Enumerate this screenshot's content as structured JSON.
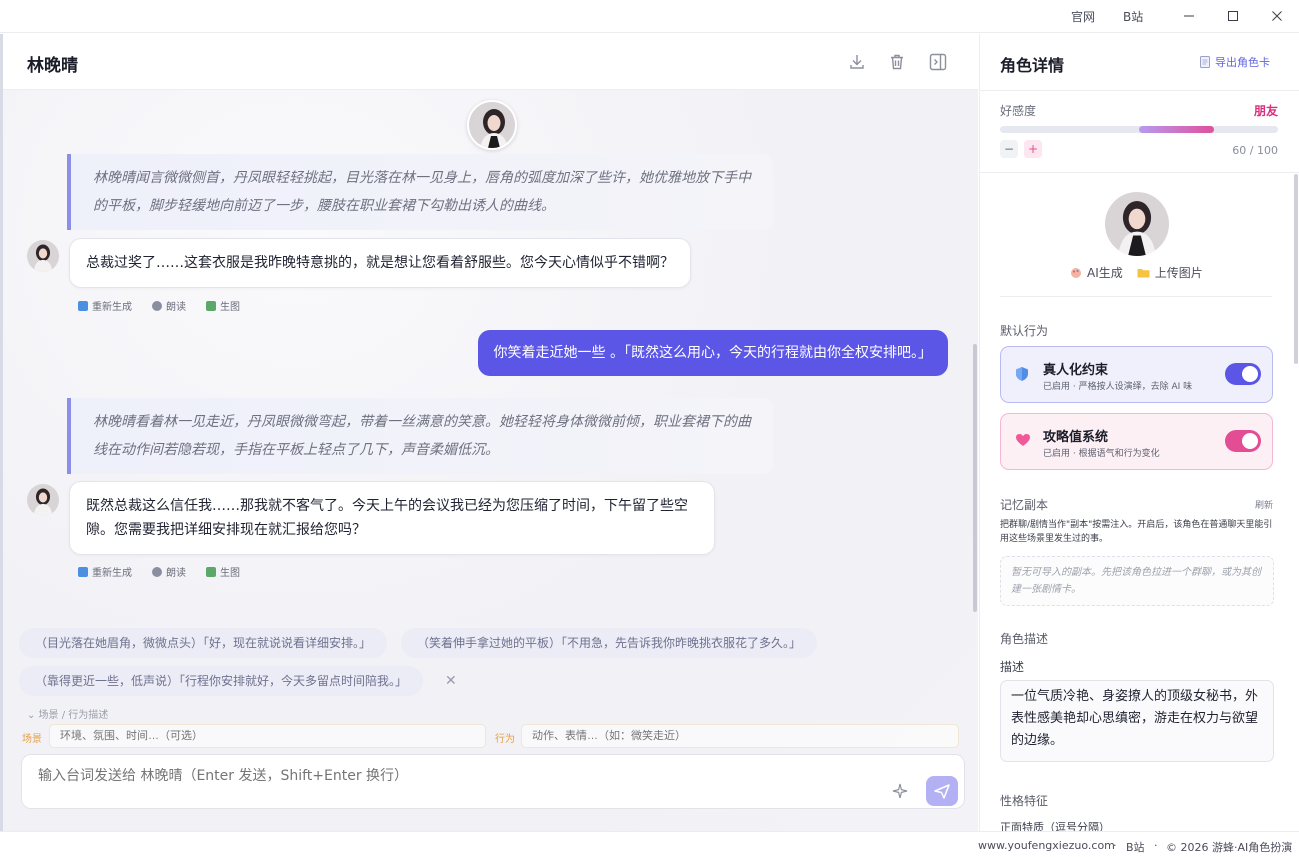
{
  "titlebar": {
    "links": [
      "官网",
      "B站"
    ]
  },
  "chat": {
    "title": "林晚晴",
    "header_icons": [
      "download-icon",
      "trash-icon",
      "sidebar-toggle-icon"
    ],
    "messages": [
      {
        "type": "narration",
        "text": "林晚晴闻言微微侧首，丹凤眼轻轻挑起，目光落在林一见身上，唇角的弧度加深了些许，她优雅地放下手中的平板，脚步轻缓地向前迈了一步，腰肢在职业套裙下勾勒出诱人的曲线。"
      },
      {
        "type": "ai",
        "text": "总裁过奖了……这套衣服是我昨晚特意挑的，就是想让您看着舒服些。您今天心情似乎不错啊？"
      },
      {
        "type": "user",
        "text": "你笑着走近她一些 。「既然这么用心，今天的行程就由你全权安排吧。」"
      },
      {
        "type": "narration",
        "text": "林晚晴看着林一见走近，丹凤眼微微弯起，带着一丝满意的笑意。她轻轻将身体微微前倾，职业套裙下的曲线在动作间若隐若现，手指在平板上轻点了几下，声音柔媚低沉。"
      },
      {
        "type": "ai",
        "text": "既然总裁这么信任我……那我就不客气了。今天上午的会议我已经为您压缩了时间，下午留了些空隙。您需要我把详细安排现在就汇报给您吗？"
      }
    ],
    "message_actions": [
      "重新生成",
      "朗读",
      "生图"
    ],
    "suggestions": [
      "（目光落在她眉角，微微点头）「好，现在就说说看详细安排。」",
      "（笑着伸手拿过她的平板）「不用急，先告诉我你昨晚挑衣服花了多久。」",
      "（靠得更近一些，低声说）「行程你安排就好，今天多留点时间陪我。」"
    ],
    "suggestion_close": "✕",
    "scene_toggle": "⌄ 场景 / 行为描述",
    "scene_label": "场景",
    "scene_placeholder": "环境、氛围、时间…（可选）",
    "action_label": "行为",
    "action_placeholder": "动作、表情…（如：微笑走近）",
    "composer_placeholder": "输入台词发送给 林晚晴（Enter 发送，Shift+Enter 换行）"
  },
  "panel": {
    "title": "角色详情",
    "export_label": "导出角色卡",
    "favor": {
      "label": "好感度",
      "level": "朋友",
      "value": 60,
      "max": 100,
      "display": "60 / 100",
      "fill_start": 0.5,
      "minus": "−",
      "plus": "+"
    },
    "portrait_actions": [
      "AI生成",
      "上传图片"
    ],
    "default_behavior_title": "默认行为",
    "behaviors": [
      {
        "name": "真人化约束",
        "desc": "已启用 · 严格按人设演绎，去除 AI 味",
        "enabled": true,
        "color": "#5b56e6"
      },
      {
        "name": "攻略值系统",
        "desc": "已启用 · 根据语气和行为变化",
        "enabled": true,
        "color": "#e24d94"
      }
    ],
    "memory": {
      "title": "记忆副本",
      "refresh": "刷新",
      "desc": "把群聊/剧情当作\"副本\"按需注入。开启后，该角色在普通聊天里能引用这些场景里发生过的事。",
      "empty": "暂无可导入的副本。先把该角色拉进一个群聊，或为其创建一张剧情卡。"
    },
    "description": {
      "title": "角色描述",
      "label": "描述",
      "text": "一位气质冷艳、身姿撩人的顶级女秘书，外表性感美艳却心思缜密，游走在权力与欲望的边缘。"
    },
    "traits": {
      "title": "性格特征",
      "positive_label": "正面特质（逗号分隔）"
    }
  },
  "footer": {
    "site": "www.youfengxiezuo.com",
    "sep1": "·",
    "bilibili": "B站",
    "sep2": "·",
    "copyright": "© 2026 游蜂·AI角色扮演"
  },
  "colors": {
    "accent": "#5b56e6",
    "pink": "#e24d94",
    "narration_border": "#8b8fe8"
  }
}
